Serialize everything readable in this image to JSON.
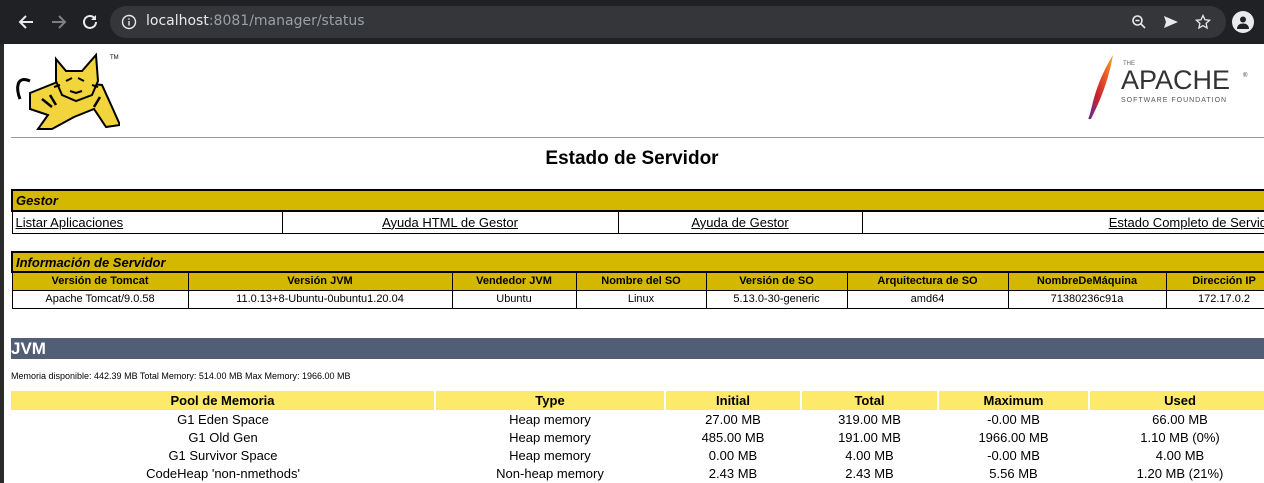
{
  "browser": {
    "url_host": "localhost",
    "url_path": ":8081/manager/status"
  },
  "page": {
    "title": "Estado de Servidor"
  },
  "gestor": {
    "header": "Gestor",
    "links": [
      "Listar Aplicaciones",
      "Ayuda HTML de Gestor",
      "Ayuda de Gestor",
      "Estado Completo de Servidor"
    ]
  },
  "server_info": {
    "header": "Información de Servidor",
    "columns": [
      "Versión de Tomcat",
      "Versión JVM",
      "Vendedor JVM",
      "Nombre del SO",
      "Versión de SO",
      "Arquitectura de SO",
      "NombreDeMáquina",
      "Dirección IP"
    ],
    "values": [
      "Apache Tomcat/9.0.58",
      "11.0.13+8-Ubuntu-0ubuntu1.20.04",
      "Ubuntu",
      "Linux",
      "5.13.0-30-generic",
      "amd64",
      "71380236c91a",
      "172.17.0.2"
    ]
  },
  "jvm": {
    "title": "JVM",
    "memory_text": "Memoria disponible: 442.39 MB Total Memory: 514.00 MB Max Memory: 1966.00 MB",
    "pool_columns": [
      "Pool de Memoria",
      "Type",
      "Initial",
      "Total",
      "Maximum",
      "Used"
    ],
    "pools": [
      [
        "G1 Eden Space",
        "Heap memory",
        "27.00 MB",
        "319.00 MB",
        "-0.00 MB",
        "66.00 MB"
      ],
      [
        "G1 Old Gen",
        "Heap memory",
        "485.00 MB",
        "191.00 MB",
        "1966.00 MB",
        "1.10 MB (0%)"
      ],
      [
        "G1 Survivor Space",
        "Heap memory",
        "0.00 MB",
        "4.00 MB",
        "-0.00 MB",
        "4.00 MB"
      ],
      [
        "CodeHeap 'non-nmethods'",
        "Non-heap memory",
        "2.43 MB",
        "2.43 MB",
        "5.56 MB",
        "1.20 MB (21%)"
      ]
    ]
  },
  "logos": {
    "apache_small": "THE",
    "apache_word": "APACHE",
    "apache_sub": "SOFTWARE FOUNDATION",
    "tomcat_tm": "TM",
    "apache_reg": "®"
  }
}
